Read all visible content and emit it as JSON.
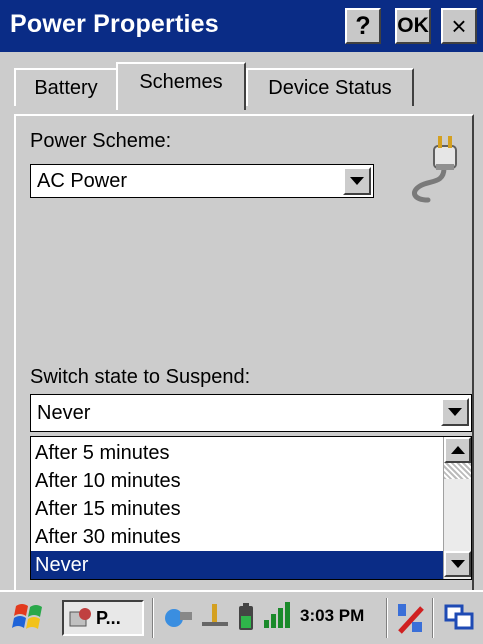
{
  "window": {
    "title": "Power Properties",
    "help_label": "?",
    "ok_label": "OK",
    "close_label": "×"
  },
  "tabs": [
    {
      "label": "Battery"
    },
    {
      "label": "Schemes"
    },
    {
      "label": "Device Status"
    }
  ],
  "power_scheme": {
    "label": "Power Scheme:",
    "value": "AC Power"
  },
  "suspend": {
    "label": "Switch state to Suspend:",
    "value": "Never",
    "options": [
      "After 5 minutes",
      "After 10 minutes",
      "After 15 minutes",
      "After 30 minutes",
      "Never"
    ],
    "selected": "Never"
  },
  "taskbar": {
    "task_label": "P...",
    "clock": "3:03 PM"
  },
  "colors": {
    "titlebar": "#0a2c86",
    "selection": "#0a2c86",
    "face": "#cccccc"
  }
}
